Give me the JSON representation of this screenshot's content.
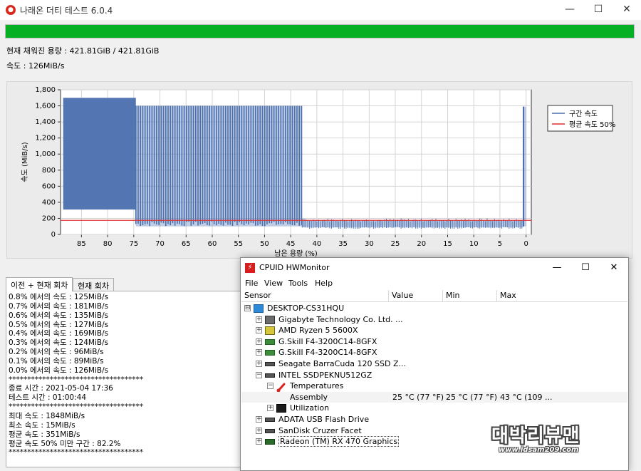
{
  "window": {
    "title": "나래온 더티 테스트 6.0.4"
  },
  "progress": {
    "fraction": 1.0
  },
  "stats": {
    "filled": "현재 채워진 용량 : 421.81GiB / 421.81GiB",
    "speed": "속도 : 126MiB/s"
  },
  "chart_data": {
    "type": "line",
    "xlabel": "남은 용량 (%)",
    "ylabel": "속도 (MiB/s)",
    "xlim": [
      89,
      -1
    ],
    "ylim": [
      0,
      1800
    ],
    "x_ticks": [
      "85",
      "80",
      "75",
      "70",
      "65",
      "60",
      "55",
      "50",
      "45",
      "40",
      "35",
      "30",
      "25",
      "20",
      "15",
      "10",
      "5",
      "0"
    ],
    "y_ticks": [
      "0",
      "200",
      "400",
      "600",
      "800",
      "1,000",
      "1,200",
      "1,400",
      "1,600",
      "1,800"
    ],
    "grid": true,
    "legend_position": "right",
    "series": [
      {
        "name": "구간 속도",
        "color": "#4a6fae",
        "segments": [
          {
            "x_start": 88.5,
            "x_end": 74.6,
            "low": 310,
            "high": 1700
          },
          {
            "x_start": 74.6,
            "x_end": 42.8,
            "low": 100,
            "high": 1600
          },
          {
            "x_start": 42.8,
            "x_end": 0.5,
            "low": 90,
            "high": 180
          },
          {
            "x_start": 0.5,
            "x_end": 0.0,
            "low": 100,
            "high": 1590
          }
        ]
      },
      {
        "name": "평균 속도 50%",
        "color": "#e03030",
        "value": 175
      }
    ]
  },
  "tabs": [
    {
      "label": "이전 + 현재 회차"
    },
    {
      "label": "현재 회차"
    }
  ],
  "log": [
    "0.8% 에서의 속도 : 125MiB/s",
    "0.7% 에서의 속도 : 181MiB/s",
    "0.6% 에서의 속도 : 135MiB/s",
    "0.5% 에서의 속도 : 127MiB/s",
    "0.4% 에서의 속도 : 169MiB/s",
    "0.3% 에서의 속도 : 124MiB/s",
    "0.2% 에서의 속도 : 96MiB/s",
    "0.1% 에서의 속도 : 89MiB/s",
    "0.0% 에서의 속도 : 126MiB/s",
    "************************************",
    "종료 시간 : 2021-05-04 17:36",
    "테스트 시간 : 01:00:44",
    "************************************",
    "최대 속도 : 1848MiB/s",
    "최소 속도 : 15MiB/s",
    "평균 속도 : 351MiB/s",
    "평균 속도 50% 미만 구간 : 82.2%",
    "************************************"
  ],
  "hwmonitor": {
    "title": "CPUID HWMonitor",
    "menu": [
      "File",
      "View",
      "Tools",
      "Help"
    ],
    "columns": [
      "Sensor",
      "Value",
      "Min",
      "Max"
    ],
    "rows": [
      {
        "label": "DESKTOP-CS31HQU",
        "icon": "computer-icon",
        "exp": "⊟"
      },
      {
        "label": "Gigabyte Technology Co. Ltd. ...",
        "icon": "motherboard-icon",
        "exp": "+"
      },
      {
        "label": "AMD Ryzen 5 5600X",
        "icon": "cpu-icon",
        "exp": "+"
      },
      {
        "label": "G.Skill F4-3200C14-8GFX",
        "icon": "memory-icon",
        "exp": "+"
      },
      {
        "label": "G.Skill F4-3200C14-8GFX",
        "icon": "memory-icon",
        "exp": "+"
      },
      {
        "label": "Seagate BarraCuda 120 SSD Z...",
        "icon": "drive-icon",
        "exp": "+"
      },
      {
        "label": "INTEL SSDPEKNU512GZ",
        "icon": "drive-icon",
        "exp": "−"
      },
      {
        "label": "Temperatures",
        "icon": "thermometer-icon",
        "exp": "−"
      },
      {
        "label": "Assembly",
        "value": "25 °C  (77 °F)",
        "min": "25 °C  (77 °F)",
        "max": "43 °C  (109 ..."
      },
      {
        "label": "Utilization",
        "icon": "utilization-icon",
        "exp": "+"
      },
      {
        "label": "ADATA USB Flash Drive",
        "icon": "drive-icon",
        "exp": "+"
      },
      {
        "label": "SanDisk Cruzer Facet",
        "icon": "drive-icon",
        "exp": "+"
      },
      {
        "label": "Radeon (TM) RX 470 Graphics",
        "icon": "gpu-icon",
        "exp": "+"
      }
    ]
  },
  "watermark": {
    "main": "대박리뷰맨",
    "url": "www.idsam209.com"
  }
}
